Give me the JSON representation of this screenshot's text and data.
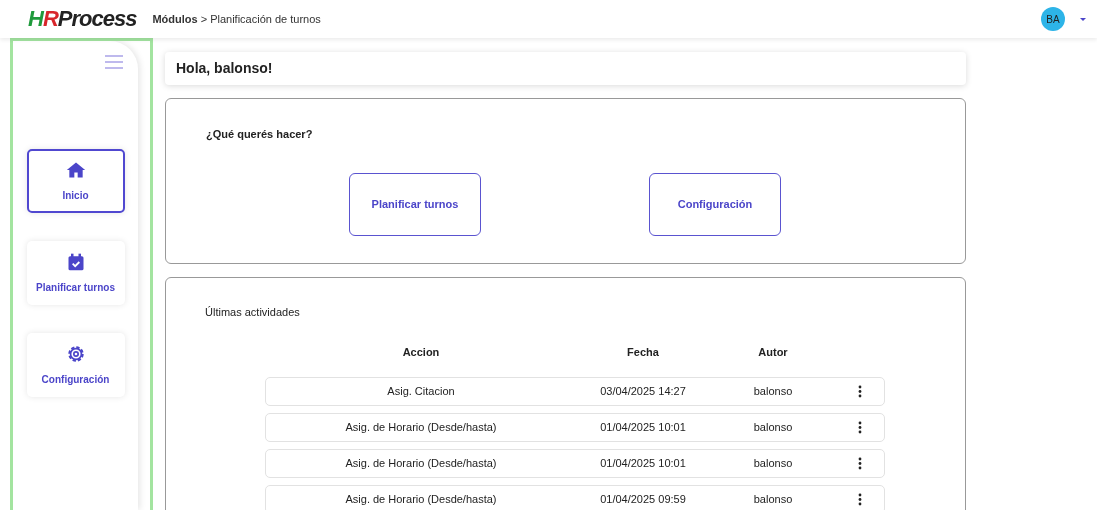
{
  "logo": [
    {
      "text": "H",
      "color": "#1f9a3c"
    },
    {
      "text": "R",
      "color": "#d8262b"
    },
    {
      "text": "Process",
      "color": "#222222"
    }
  ],
  "breadcrumb": {
    "parent": "Módulos",
    "separator": ">",
    "current": "Planificación de turnos"
  },
  "user": {
    "initials": "BA"
  },
  "sidebar": {
    "items": [
      {
        "label": "Inicio",
        "selected": true
      },
      {
        "label": "Planificar turnos",
        "selected": false
      },
      {
        "label": "Configuración",
        "selected": false
      }
    ]
  },
  "greeting": "Hola, balonso!",
  "actions": {
    "title": "¿Qué querés hacer?",
    "buttons": [
      "Planificar turnos",
      "Configuración"
    ]
  },
  "activities": {
    "title": "Últimas actividades",
    "columns": [
      "Accion",
      "Fecha",
      "Autor"
    ],
    "rows": [
      [
        "Asig. Citacion",
        "03/04/2025 14:27",
        "balonso"
      ],
      [
        "Asig. de Horario (Desde/hasta)",
        "01/04/2025 10:01",
        "balonso"
      ],
      [
        "Asig. de Horario (Desde/hasta)",
        "01/04/2025 10:01",
        "balonso"
      ],
      [
        "Asig. de Horario (Desde/hasta)",
        "01/04/2025 09:59",
        "balonso"
      ]
    ]
  }
}
